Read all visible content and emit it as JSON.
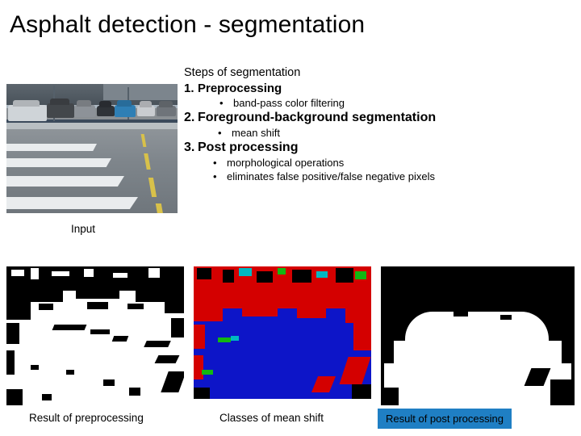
{
  "slide": {
    "title": "Asphalt detection - segmentation",
    "steps_heading": "Steps of segmentation",
    "steps": [
      {
        "number": "1.",
        "label": "Preprocessing",
        "subitems": [
          {
            "bullet": "•",
            "text": "band-pass color filtering"
          }
        ]
      },
      {
        "number": "2.",
        "label": "Foreground-background segmentation",
        "subitems": [
          {
            "bullet": "•",
            "text": "mean shift"
          }
        ]
      },
      {
        "number": "3.",
        "label": "Post processing",
        "subitems": [
          {
            "bullet": "•",
            "text": "morphological operations"
          },
          {
            "bullet": "•",
            "text": "eliminates false positive/false negative pixels"
          }
        ]
      }
    ],
    "captions": {
      "input": "Input",
      "preprocessing": "Result of preprocessing",
      "mean_shift": "Classes of mean shift",
      "post_processing": "Result of post processing"
    },
    "colors": {
      "highlight": "#1f7fc4",
      "mean_shift_background": "#0d15c8",
      "mean_shift_class_red": "#d40000",
      "text": "#000000",
      "page_background": "#ffffff"
    }
  }
}
